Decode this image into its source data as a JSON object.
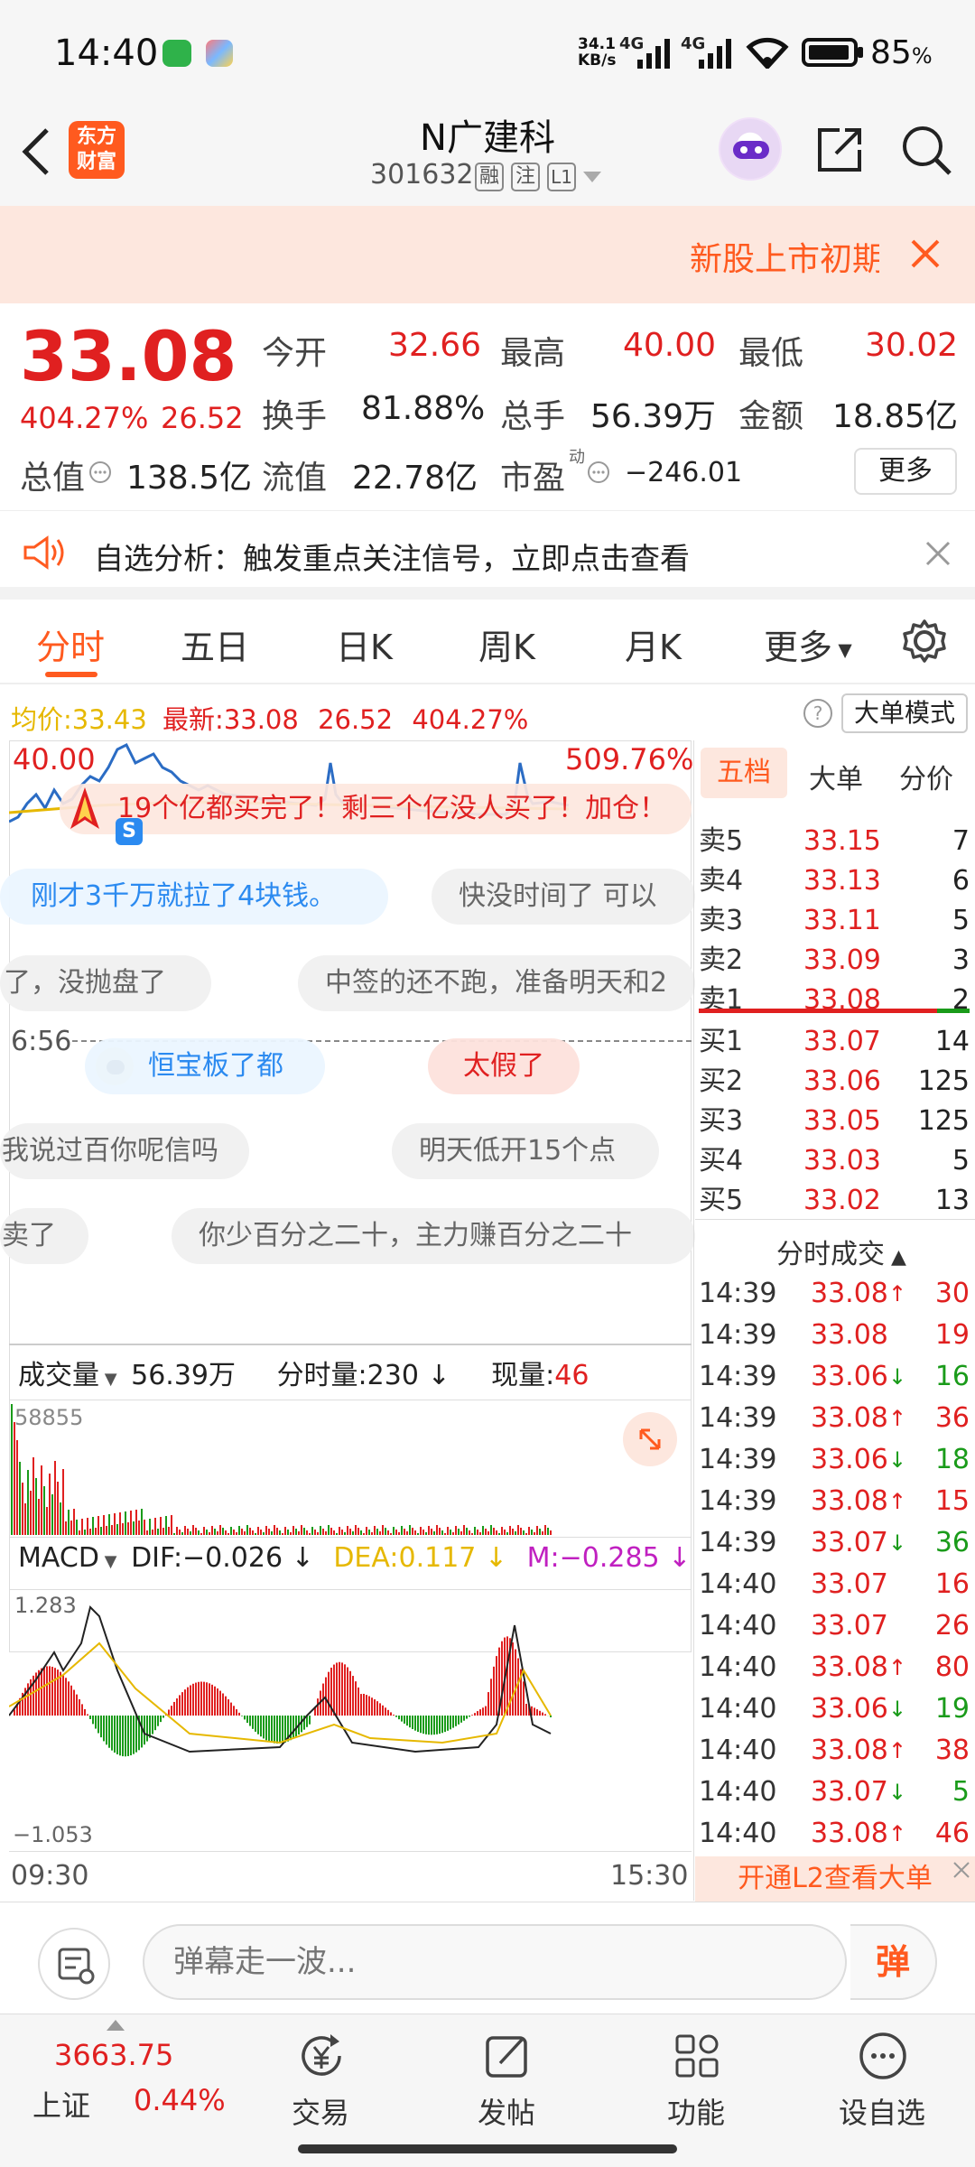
{
  "status": {
    "time": "14:40",
    "net_speed": "34.1",
    "net_unit": "KB/s",
    "sig1": "4G",
    "sig2": "4G",
    "battery": "85",
    "battery_unit": "%"
  },
  "header": {
    "logo_line1": "东方",
    "logo_line2": "财富",
    "stock_name": "N广建科",
    "stock_code": "301632",
    "badges": [
      "融",
      "注",
      "L1"
    ]
  },
  "banner": {
    "text": "新股上市初期"
  },
  "quote": {
    "price": "33.08",
    "change_pct": "404.27%",
    "change": "26.52",
    "fields": [
      {
        "label": "今开",
        "value": "32.66",
        "color": "red"
      },
      {
        "label": "最高",
        "value": "40.00",
        "color": "red"
      },
      {
        "label": "最低",
        "value": "30.02",
        "color": "red"
      },
      {
        "label": "换手",
        "value": "81.88%",
        "color": "dark"
      },
      {
        "label": "总手",
        "value": "56.39万",
        "color": "dark"
      },
      {
        "label": "金额",
        "value": "18.85亿",
        "color": "dark"
      }
    ],
    "total_value_label": "总值",
    "total_value": "138.5亿",
    "float_label": "流值",
    "float_value": "22.78亿",
    "pe_label": "市盈",
    "pe_sup": "动",
    "pe_value": "−246.01",
    "more_label": "更多"
  },
  "alert": {
    "text": "自选分析：触发重点关注信号，立即点击查看"
  },
  "tabs": [
    {
      "label": "分时"
    },
    {
      "label": "五日"
    },
    {
      "label": "日K"
    },
    {
      "label": "周K"
    },
    {
      "label": "月K"
    },
    {
      "label": "更多"
    }
  ],
  "info": {
    "avg_label": "均价:",
    "avg": "33.43",
    "latest_label": "最新:",
    "latest": "33.08",
    "change": "26.52",
    "pct": "404.27%",
    "mode_label": "大单模式"
  },
  "intraday": {
    "top_price": "40.00",
    "top_pct": "509.76%",
    "time_mark": "6:56"
  },
  "danmu": [
    {
      "text": "19个亿都买完了！剩三个亿没人买了！加仓！"
    },
    {
      "text": "刚才3千万就拉了4块钱。"
    },
    {
      "text": "快没时间了  可以"
    },
    {
      "text": "了，没抛盘了"
    },
    {
      "text": "中签的还不跑，准备明天和2"
    },
    {
      "text": "恒宝板了都"
    },
    {
      "text": "太假了"
    },
    {
      "text": "我说过百你呢信吗"
    },
    {
      "text": "明天低开15个点"
    },
    {
      "text": "卖了"
    },
    {
      "text": "你少百分之二十，主力赚百分之二十"
    }
  ],
  "volume": {
    "label": "成交量",
    "total": "56.39万",
    "minute_label": "分时量:",
    "minute": "230",
    "current_label": "现量:",
    "current": "46",
    "max": "58855"
  },
  "macd": {
    "label": "MACD",
    "dif_label": "DIF:",
    "dif": "−0.026",
    "dea_label": "DEA:",
    "dea": "0.117",
    "m_label": "M:",
    "m": "−0.285",
    "top": "1.283",
    "bottom": "−1.053"
  },
  "time_axis": {
    "start": "09:30",
    "end": "15:30"
  },
  "orderbook": {
    "tabs": [
      "五档",
      "大单",
      "分价"
    ],
    "sells": [
      {
        "label": "卖5",
        "price": "33.15",
        "vol": "7"
      },
      {
        "label": "卖4",
        "price": "33.13",
        "vol": "6"
      },
      {
        "label": "卖3",
        "price": "33.11",
        "vol": "5"
      },
      {
        "label": "卖2",
        "price": "33.09",
        "vol": "3"
      },
      {
        "label": "卖1",
        "price": "33.08",
        "vol": "2"
      }
    ],
    "buys": [
      {
        "label": "买1",
        "price": "33.07",
        "vol": "14"
      },
      {
        "label": "买2",
        "price": "33.06",
        "vol": "125"
      },
      {
        "label": "买3",
        "price": "33.05",
        "vol": "125"
      },
      {
        "label": "买4",
        "price": "33.03",
        "vol": "5"
      },
      {
        "label": "买5",
        "price": "33.02",
        "vol": "13"
      }
    ]
  },
  "trades": {
    "title": "分时成交",
    "rows": [
      {
        "time": "14:39",
        "price": "33.08",
        "dir": "up",
        "vol": "30"
      },
      {
        "time": "14:39",
        "price": "33.08",
        "dir": "",
        "vol": "19"
      },
      {
        "time": "14:39",
        "price": "33.06",
        "dir": "down",
        "vol": "16"
      },
      {
        "time": "14:39",
        "price": "33.08",
        "dir": "up",
        "vol": "36"
      },
      {
        "time": "14:39",
        "price": "33.06",
        "dir": "down",
        "vol": "18"
      },
      {
        "time": "14:39",
        "price": "33.08",
        "dir": "up",
        "vol": "15"
      },
      {
        "time": "14:39",
        "price": "33.07",
        "dir": "down",
        "vol": "36"
      },
      {
        "time": "14:40",
        "price": "33.07",
        "dir": "",
        "vol": "16"
      },
      {
        "time": "14:40",
        "price": "33.07",
        "dir": "",
        "vol": "26"
      },
      {
        "time": "14:40",
        "price": "33.08",
        "dir": "up",
        "vol": "80"
      },
      {
        "time": "14:40",
        "price": "33.06",
        "dir": "down",
        "vol": "19"
      },
      {
        "time": "14:40",
        "price": "33.08",
        "dir": "up",
        "vol": "38"
      },
      {
        "time": "14:40",
        "price": "33.07",
        "dir": "down",
        "vol": "5"
      },
      {
        "time": "14:40",
        "price": "33.08",
        "dir": "up",
        "vol": "46"
      }
    ],
    "l2_label": "开通L2查看大单"
  },
  "input": {
    "placeholder": "弹幕走一波...",
    "danmu_button": "弹"
  },
  "bottom": {
    "index_value": "3663.75",
    "index_name": "上证",
    "index_pct": "0.44%",
    "items": [
      {
        "label": "交易"
      },
      {
        "label": "发帖"
      },
      {
        "label": "功能"
      },
      {
        "label": "设自选"
      }
    ]
  },
  "colors": {
    "up": "#e02020",
    "down": "#1a9b1a",
    "accent": "#ff5a1f",
    "dea": "#e6b800",
    "m": "#c020c0"
  }
}
